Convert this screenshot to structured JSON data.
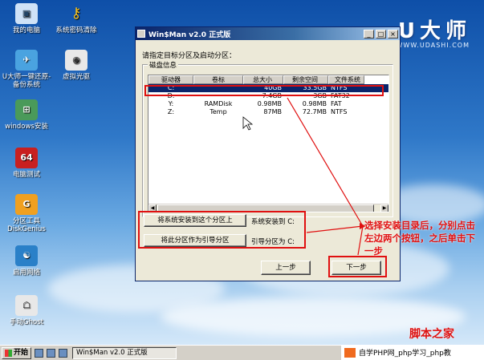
{
  "desktop": {
    "icons": [
      {
        "label": "我的电脑"
      },
      {
        "label": "系统密码清除"
      },
      {
        "label": "U大师一键还原-备份系统"
      },
      {
        "label": "虚拟光驱"
      },
      {
        "label": "windows安装"
      },
      {
        "label": "电脑测试"
      },
      {
        "label": "分区工具DiskGenius"
      },
      {
        "label": "启用网络"
      },
      {
        "label": "手动Ghost"
      }
    ],
    "brand": "U大师",
    "brand_url": "WWW.UDASHI.COM"
  },
  "window": {
    "title": "Win$Man v2.0 正式版",
    "buttons": {
      "minimize": "_",
      "maximize": "□",
      "close": "×"
    },
    "prompt": "请指定目标分区及启动分区：",
    "group_label": "磁盘信息",
    "columns": [
      "驱动器",
      "卷标",
      "总大小",
      "剩余空间",
      "文件系统"
    ],
    "rows": [
      {
        "drive": "C:",
        "label": "",
        "total": "40GB",
        "free": "33.5GB",
        "fs": "NTFS",
        "selected": true
      },
      {
        "drive": "D:",
        "label": "",
        "total": "7.4GB",
        "free": "3GB",
        "fs": "FAT32",
        "selected": false
      },
      {
        "drive": "Y:",
        "label": "RAMDisk",
        "total": "0.98MB",
        "free": "0.98MB",
        "fs": "FAT",
        "selected": false
      },
      {
        "drive": "Z:",
        "label": "Temp",
        "total": "87MB",
        "free": "72.7MB",
        "fs": "NTFS",
        "selected": false
      }
    ],
    "install_button": "将系统安装到这个分区上",
    "install_label": "系统安装到  C:",
    "boot_button": "将此分区作为引导分区",
    "boot_label": "引导分区为  C:",
    "prev_button": "上一步",
    "next_button": "下一步"
  },
  "annotation": "选择安装目录后，分别点击左边两个按钮，之后单击下一步",
  "watermark": "脚本之家",
  "taskbar": {
    "start": "开始",
    "task": "Win$Man v2.0 正式版",
    "php": "自学PHP网_php学习_php教"
  }
}
